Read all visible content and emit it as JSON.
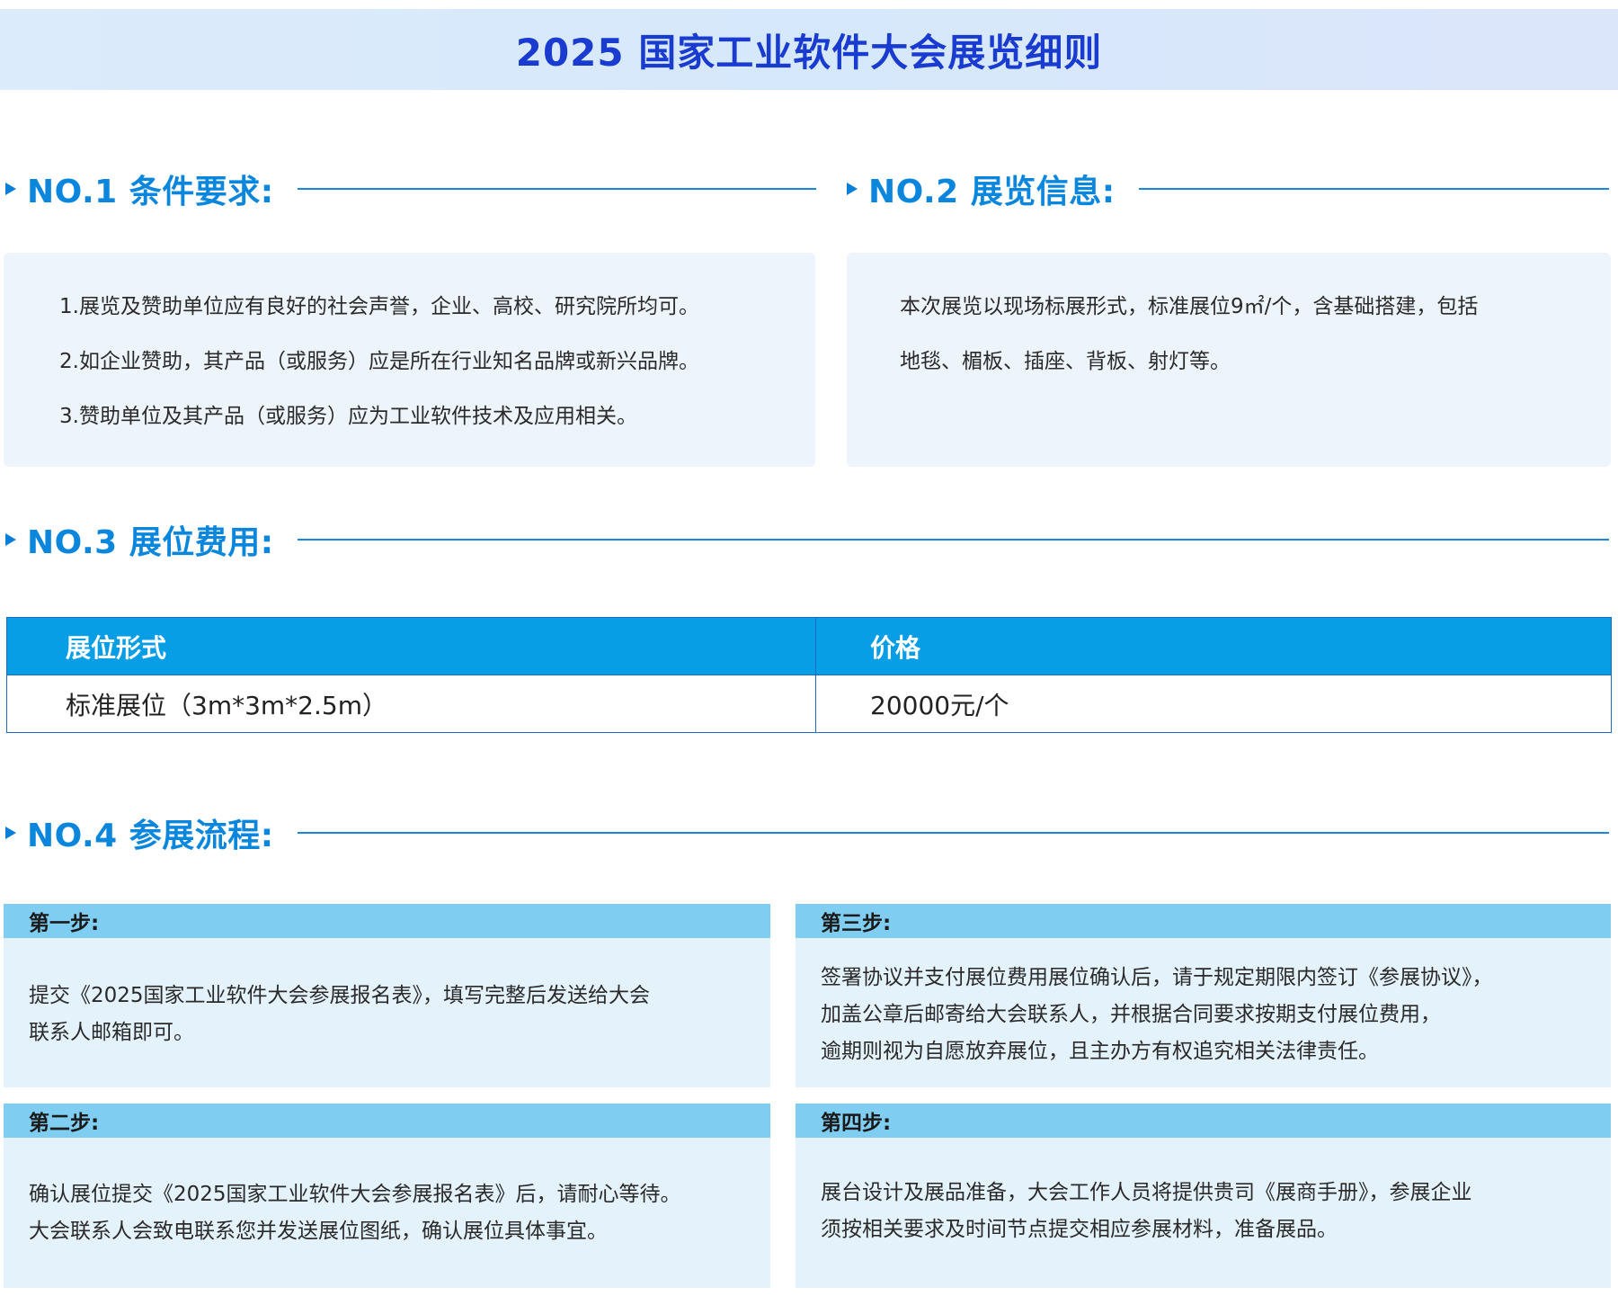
{
  "banner": {
    "title": "2025 国家工业软件大会展览细则"
  },
  "sections": {
    "s1": {
      "title": "NO.1 条件要求:"
    },
    "s2": {
      "title": "NO.2 展览信息:"
    },
    "s3": {
      "title": "NO.3 展位费用:"
    },
    "s4": {
      "title": "NO.4 参展流程:"
    }
  },
  "requirements": {
    "items": [
      "1.展览及赞助单位应有良好的社会声誉，企业、高校、研究院所均可。",
      "2.如企业赞助，其产品（或服务）应是所在行业知名品牌或新兴品牌。",
      "3.赞助单位及其产品（或服务）应为工业软件技术及应用相关。"
    ]
  },
  "exhibition_info": {
    "lines": [
      "本次展览以现场标展形式，标准展位9㎡/个，含基础搭建，包括",
      "地毯、楣板、插座、背板、射灯等。"
    ]
  },
  "fee_table": {
    "headers": [
      "展位形式",
      "价格"
    ],
    "rows": [
      [
        "标准展位（3m*3m*2.5m）",
        "20000元/个"
      ]
    ]
  },
  "steps": {
    "step1": {
      "label": "第一步:",
      "lines": [
        "提交《2025国家工业软件大会参展报名表》，填写完整后发送给大会",
        "联系人邮箱即可。"
      ]
    },
    "step2": {
      "label": "第二步:",
      "lines": [
        "确认展位提交《2025国家工业软件大会参展报名表》后，请耐心等待。",
        "大会联系人会致电联系您并发送展位图纸，确认展位具体事宜。"
      ]
    },
    "step3": {
      "label": "第三步:",
      "lines": [
        "签署协议并支付展位费用展位确认后，请于规定期限内签订《参展协议》，",
        "加盖公章后邮寄给大会联系人，并根据合同要求按期支付展位费用，",
        "逾期则视为自愿放弃展位，且主办方有权追究相关法律责任。"
      ]
    },
    "step4": {
      "label": "第四步:",
      "lines": [
        "展台设计及展品准备，大会工作人员将提供贵司《展商手册》，参展企业",
        "须按相关要求及时间节点提交相应参展材料，准备展品。"
      ]
    }
  },
  "colors": {
    "banner_title": "#1a3bd0",
    "section_title": "#0a86dd",
    "table_header": "#079ee6",
    "step_header": "#7fcdf1",
    "step_body": "#e4f2fb",
    "card_bg": "#eef4fb"
  }
}
